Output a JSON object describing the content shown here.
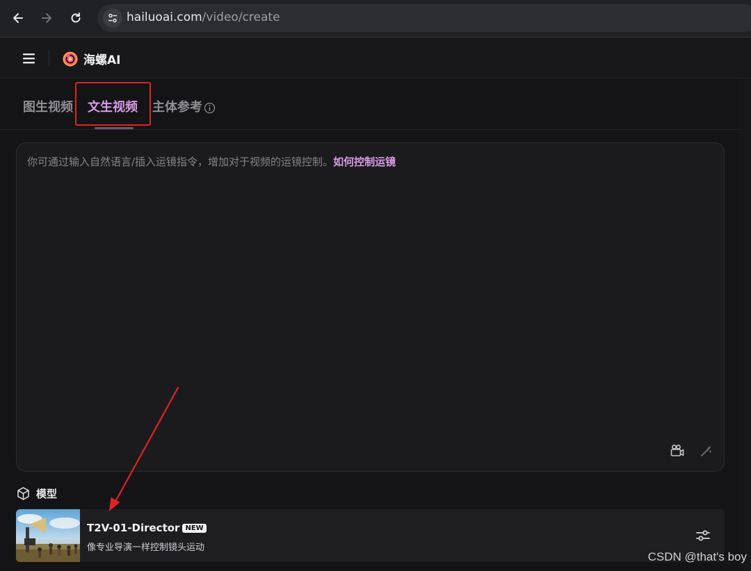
{
  "browser": {
    "url_domain": "hailuoai.com",
    "url_path": "/video/create",
    "icons": [
      "back-arrow-icon",
      "forward-arrow-icon",
      "reload-icon",
      "site-settings-icon"
    ]
  },
  "header": {
    "app_name": "海螺AI",
    "icons": [
      "hamburger-menu-icon",
      "hailuo-logo-icon"
    ]
  },
  "tabs": [
    {
      "label": "图生视频",
      "active": false
    },
    {
      "label": "文生视频",
      "active": true
    },
    {
      "label": "主体参考",
      "active": false
    }
  ],
  "prompt": {
    "placeholder": "你可通过输入自然语言/插入运镜指令，增加对于视频的运镜控制。",
    "help_link": "如何控制运镜",
    "icons": [
      "camera-movement-icon",
      "magic-wand-icon"
    ]
  },
  "model_section": {
    "label": "模型",
    "model_name": "T2V-01-Director",
    "badge": "NEW",
    "description": "像专业导演一样控制镜头运动",
    "icons": [
      "cube-icon",
      "sliders-icon"
    ]
  },
  "watermark": "CSDN @that's boy",
  "colors": {
    "accent": "#d89be6",
    "background": "#141416",
    "annotation_red": "#e02323"
  }
}
